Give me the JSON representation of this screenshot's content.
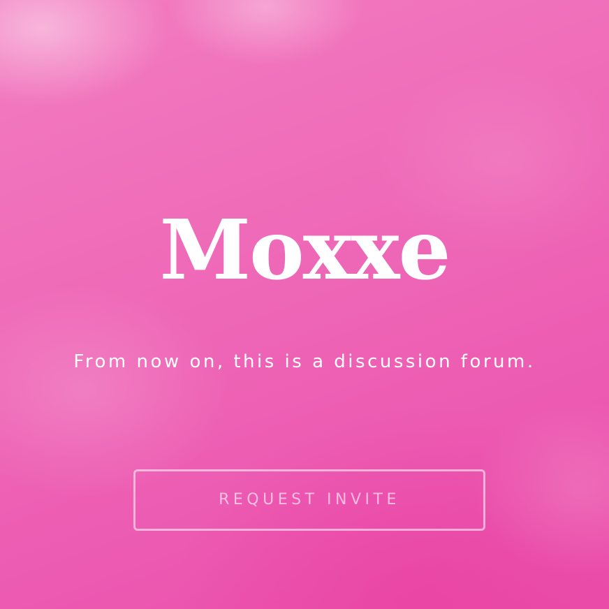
{
  "brand": {
    "logo_text": "Moxxe"
  },
  "hero": {
    "tagline": "From now on, this is a discussion forum."
  },
  "cta": {
    "request_invite_label": "REQUEST INVITE"
  },
  "colors": {
    "background_pink": "#ee5fb2",
    "text_white": "#ffffff"
  }
}
